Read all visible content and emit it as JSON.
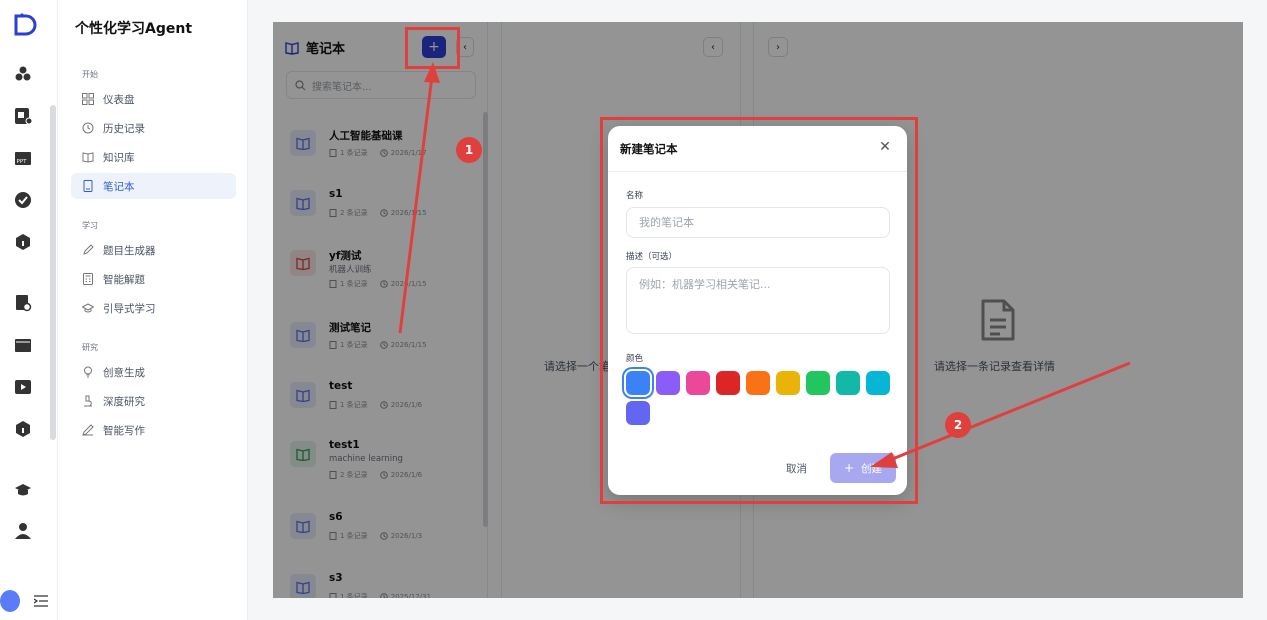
{
  "app": {
    "title": "个性化学习Agent"
  },
  "sidebar": {
    "sections": [
      {
        "label": "开始",
        "items": [
          {
            "label": "仪表盘",
            "icon": "dashboard-icon"
          },
          {
            "label": "历史记录",
            "icon": "history-icon"
          },
          {
            "label": "知识库",
            "icon": "knowledge-book-icon"
          },
          {
            "label": "笔记本",
            "icon": "notebook-icon",
            "active": true
          }
        ]
      },
      {
        "label": "学习",
        "items": [
          {
            "label": "题目生成器",
            "icon": "pen-icon"
          },
          {
            "label": "智能解题",
            "icon": "calculator-icon"
          },
          {
            "label": "引导式学习",
            "icon": "graduation-cap-icon"
          }
        ]
      },
      {
        "label": "研究",
        "items": [
          {
            "label": "创意生成",
            "icon": "lightbulb-icon"
          },
          {
            "label": "深度研究",
            "icon": "microscope-icon"
          },
          {
            "label": "智能写作",
            "icon": "pencil-icon"
          }
        ]
      }
    ]
  },
  "notebooks": {
    "header": "笔记本",
    "add_label": "+",
    "collapse_label": "‹",
    "search_placeholder": "搜索笔记本...",
    "items": [
      {
        "title": "人工智能基础课",
        "desc": "",
        "count": "1 条记录",
        "date": "2026/1/17",
        "color": "#5b6ee8"
      },
      {
        "title": "s1",
        "desc": "",
        "count": "2 条记录",
        "date": "2026/1/15",
        "color": "#5b6ee8"
      },
      {
        "title": "yf测试",
        "desc": "机器人训练",
        "count": "1 条记录",
        "date": "2026/1/15",
        "color": "#d64545"
      },
      {
        "title": "测试笔记",
        "desc": "",
        "count": "1 条记录",
        "date": "2026/1/15",
        "color": "#5b6ee8"
      },
      {
        "title": "test",
        "desc": "",
        "count": "1 条记录",
        "date": "2026/1/6",
        "color": "#5b6ee8"
      },
      {
        "title": "test1",
        "desc": "machine learning",
        "count": "2 条记录",
        "date": "2026/1/6",
        "color": "#2e9e57"
      },
      {
        "title": "s6",
        "desc": "",
        "count": "1 条记录",
        "date": "2026/1/3",
        "color": "#5b6ee8"
      },
      {
        "title": "s3",
        "desc": "",
        "count": "1 条记录",
        "date": "2025/12/31",
        "color": "#5b6ee8"
      }
    ]
  },
  "middle": {
    "placeholder": "请选择一个笔",
    "prev_label": "‹"
  },
  "detail": {
    "placeholder": "请选择一条记录查看详情",
    "next_label": "›"
  },
  "dialog": {
    "title": "新建笔记本",
    "close_label": "✕",
    "name_label": "名称",
    "name_placeholder": "我的笔记本",
    "desc_label": "描述（可选）",
    "desc_placeholder": "例如：机器学习相关笔记...",
    "color_label": "颜色",
    "colors": [
      "#3b82f6",
      "#8b5cf6",
      "#ec4899",
      "#dc2626",
      "#f97316",
      "#eab308",
      "#22c55e",
      "#14b8a6",
      "#06b6d4",
      "#6366f1"
    ],
    "selected_color": "#3b82f6",
    "cancel_label": "取消",
    "create_label": "创建"
  },
  "annotations": {
    "step1": "1",
    "step2": "2",
    "accent": "#e0403d"
  }
}
